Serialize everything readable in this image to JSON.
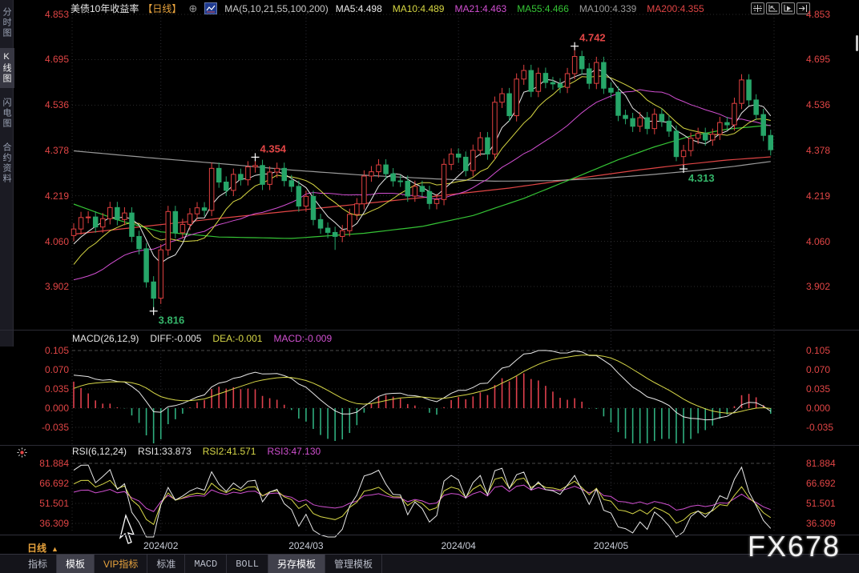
{
  "header": {
    "title": "美债10年收益率",
    "period_tag": "【日线】",
    "plus_icon": "⊕",
    "ma_label": "MA(5,10,21,55,100,200)",
    "ma_values": [
      {
        "label": "MA5:4.498",
        "color": "#e8e8e8"
      },
      {
        "label": "MA10:4.489",
        "color": "#d8d843"
      },
      {
        "label": "MA21:4.463",
        "color": "#d24fd2"
      },
      {
        "label": "MA55:4.466",
        "color": "#35c435"
      },
      {
        "label": "MA100:4.339",
        "color": "#9a9a9a"
      },
      {
        "label": "MA200:4.355",
        "color": "#e04545"
      }
    ],
    "window_icons": [
      "pan-icon",
      "axis-range-left-icon",
      "axis-play-icon",
      "page-shift-icon"
    ]
  },
  "sidebar": {
    "items": [
      {
        "label": "分时图",
        "selected": false
      },
      {
        "label": "K线图",
        "selected": true
      },
      {
        "label": "闪电图",
        "selected": false
      },
      {
        "label": "合约资料",
        "selected": false
      }
    ]
  },
  "macd_header": {
    "name": "MACD(26,12,9)",
    "diff": "DIFF:-0.005",
    "dea": "DEA:-0.001",
    "macd": "MACD:-0.009"
  },
  "rsi_header": {
    "name": "RSI(6,12,24)",
    "rsi1": "RSI1:33.873",
    "rsi2": "RSI2:41.571",
    "rsi3": "RSI3:47.130"
  },
  "bottom": {
    "period": "日线",
    "period_arrow": "▲",
    "tabs": [
      {
        "label": "指标",
        "style": "plain"
      },
      {
        "label": "模板",
        "style": "sel"
      },
      {
        "label": "VIP指标",
        "style": "vip"
      },
      {
        "label": "标准",
        "style": "plain"
      },
      {
        "label": "MACD",
        "style": "mono"
      },
      {
        "label": "BOLL",
        "style": "mono"
      },
      {
        "label": "另存模板",
        "style": "sel"
      },
      {
        "label": "管理模板",
        "style": "plain"
      }
    ]
  },
  "watermark": "FX678",
  "chart_data": {
    "type": "candlestick",
    "title": "美债10年收益率 日线",
    "main_axis_ticks": [
      "4.853",
      "4.695",
      "4.536",
      "4.378",
      "4.219",
      "4.060",
      "3.902"
    ],
    "macd_axis_ticks": [
      "0.105",
      "0.070",
      "0.035",
      "0.000",
      "-0.035"
    ],
    "rsi_axis_ticks": [
      "81.884",
      "66.692",
      "51.501",
      "36.309"
    ],
    "months": [
      {
        "label": "2024/02",
        "index": 12
      },
      {
        "label": "2024/03",
        "index": 32
      },
      {
        "label": "2024/04",
        "index": 53
      },
      {
        "label": "2024/05",
        "index": 74
      }
    ],
    "colors": {
      "up": "#e04040",
      "down": "#26a669",
      "grid": "#2b2b2b",
      "grid_bright": "#4a4a4a",
      "axis_text": "#e04545",
      "ma5": "#e8e8e8",
      "ma10": "#d8d843",
      "ma21": "#d24fd2",
      "ma55": "#35c435",
      "ma100": "#9a9a9a",
      "ma200": "#e04545",
      "macd_pos": "#e0404d",
      "macd_neg": "#2fae7e",
      "diff_line": "#e8e8e8",
      "dea_line": "#d8d848",
      "rsi1": "#e8e8e8",
      "rsi2": "#d8d848",
      "rsi3": "#d050d0",
      "annot_up": "#e04545",
      "annot_dn": "#35b56a"
    },
    "candles": [
      [
        4.08,
        4.123,
        4.06,
        4.103
      ],
      [
        4.103,
        4.163,
        4.083,
        4.143
      ],
      [
        4.143,
        4.165,
        4.123,
        4.145
      ],
      [
        4.145,
        4.165,
        4.09,
        4.11
      ],
      [
        4.11,
        4.159,
        4.09,
        4.139
      ],
      [
        4.139,
        4.198,
        4.119,
        4.178
      ],
      [
        4.178,
        4.198,
        4.116,
        4.136
      ],
      [
        4.136,
        4.179,
        4.116,
        4.159
      ],
      [
        4.159,
        4.179,
        4.057,
        4.077
      ],
      [
        4.077,
        4.097,
        4.014,
        4.034
      ],
      [
        4.034,
        4.054,
        3.898,
        3.918
      ],
      [
        3.918,
        3.938,
        3.816,
        3.861
      ],
      [
        3.861,
        4.05,
        3.841,
        4.03
      ],
      [
        4.03,
        4.184,
        4.01,
        4.164
      ],
      [
        4.164,
        4.184,
        4.07,
        4.09
      ],
      [
        4.09,
        4.139,
        4.07,
        4.119
      ],
      [
        4.119,
        4.176,
        4.099,
        4.156
      ],
      [
        4.156,
        4.197,
        4.136,
        4.177
      ],
      [
        4.177,
        4.197,
        4.148,
        4.168
      ],
      [
        4.168,
        4.335,
        4.148,
        4.315
      ],
      [
        4.315,
        4.335,
        4.247,
        4.267
      ],
      [
        4.267,
        4.287,
        4.218,
        4.238
      ],
      [
        4.238,
        4.314,
        4.218,
        4.294
      ],
      [
        4.294,
        4.314,
        4.255,
        4.275
      ],
      [
        4.275,
        4.34,
        4.255,
        4.32
      ],
      [
        4.32,
        4.354,
        4.3,
        4.325
      ],
      [
        4.325,
        4.345,
        4.239,
        4.259
      ],
      [
        4.259,
        4.322,
        4.239,
        4.302
      ],
      [
        4.302,
        4.335,
        4.282,
        4.315
      ],
      [
        4.315,
        4.335,
        4.252,
        4.272
      ],
      [
        4.272,
        4.292,
        4.232,
        4.252
      ],
      [
        4.252,
        4.272,
        4.163,
        4.183
      ],
      [
        4.183,
        4.237,
        4.163,
        4.217
      ],
      [
        4.217,
        4.237,
        4.116,
        4.136
      ],
      [
        4.136,
        4.156,
        4.086,
        4.106
      ],
      [
        4.106,
        4.126,
        4.071,
        4.091
      ],
      [
        4.091,
        4.111,
        4.03,
        4.077
      ],
      [
        4.077,
        4.117,
        4.057,
        4.097
      ],
      [
        4.097,
        4.174,
        4.077,
        4.154
      ],
      [
        4.154,
        4.211,
        4.134,
        4.191
      ],
      [
        4.191,
        4.308,
        4.171,
        4.288
      ],
      [
        4.288,
        4.323,
        4.268,
        4.303
      ],
      [
        4.303,
        4.347,
        4.283,
        4.327
      ],
      [
        4.327,
        4.347,
        4.276,
        4.296
      ],
      [
        4.296,
        4.316,
        4.251,
        4.271
      ],
      [
        4.271,
        4.291,
        4.25,
        4.27
      ],
      [
        4.27,
        4.29,
        4.198,
        4.218
      ],
      [
        4.218,
        4.272,
        4.198,
        4.252
      ],
      [
        4.252,
        4.272,
        4.214,
        4.234
      ],
      [
        4.234,
        4.254,
        4.172,
        4.192
      ],
      [
        4.192,
        4.226,
        4.172,
        4.206
      ],
      [
        4.206,
        4.349,
        4.186,
        4.329
      ],
      [
        4.329,
        4.385,
        4.309,
        4.365
      ],
      [
        4.365,
        4.385,
        4.334,
        4.354
      ],
      [
        4.354,
        4.374,
        4.287,
        4.307
      ],
      [
        4.307,
        4.398,
        4.287,
        4.378
      ],
      [
        4.378,
        4.442,
        4.358,
        4.422
      ],
      [
        4.422,
        4.442,
        4.345,
        4.365
      ],
      [
        4.365,
        4.566,
        4.345,
        4.546
      ],
      [
        4.546,
        4.596,
        4.526,
        4.576
      ],
      [
        4.576,
        4.596,
        4.479,
        4.499
      ],
      [
        4.499,
        4.647,
        4.479,
        4.627
      ],
      [
        4.627,
        4.677,
        4.607,
        4.657
      ],
      [
        4.657,
        4.677,
        4.564,
        4.584
      ],
      [
        4.584,
        4.667,
        4.564,
        4.647
      ],
      [
        4.647,
        4.667,
        4.595,
        4.615
      ],
      [
        4.615,
        4.635,
        4.59,
        4.61
      ],
      [
        4.61,
        4.63,
        4.578,
        4.598
      ],
      [
        4.598,
        4.666,
        4.578,
        4.646
      ],
      [
        4.646,
        4.742,
        4.626,
        4.706
      ],
      [
        4.706,
        4.726,
        4.643,
        4.663
      ],
      [
        4.663,
        4.683,
        4.592,
        4.612
      ],
      [
        4.612,
        4.705,
        4.592,
        4.685
      ],
      [
        4.685,
        4.705,
        4.575,
        4.595
      ],
      [
        4.595,
        4.615,
        4.561,
        4.581
      ],
      [
        4.581,
        4.601,
        4.48,
        4.5
      ],
      [
        4.5,
        4.52,
        4.469,
        4.489
      ],
      [
        4.489,
        4.509,
        4.442,
        4.462
      ],
      [
        4.462,
        4.512,
        4.442,
        4.492
      ],
      [
        4.492,
        4.512,
        4.434,
        4.454
      ],
      [
        4.454,
        4.524,
        4.434,
        4.504
      ],
      [
        4.504,
        4.524,
        4.46,
        4.48
      ],
      [
        4.48,
        4.5,
        4.425,
        4.445
      ],
      [
        4.445,
        4.465,
        4.34,
        4.356
      ],
      [
        4.356,
        4.397,
        4.313,
        4.377
      ],
      [
        4.377,
        4.44,
        4.357,
        4.42
      ],
      [
        4.42,
        4.457,
        4.4,
        4.437
      ],
      [
        4.437,
        4.457,
        4.394,
        4.414
      ],
      [
        4.414,
        4.454,
        4.394,
        4.434
      ],
      [
        4.434,
        4.495,
        4.414,
        4.475
      ],
      [
        4.475,
        4.495,
        4.447,
        4.467
      ],
      [
        4.467,
        4.562,
        4.447,
        4.542
      ],
      [
        4.542,
        4.644,
        4.522,
        4.624
      ],
      [
        4.624,
        4.644,
        4.534,
        4.554
      ],
      [
        4.554,
        4.574,
        4.483,
        4.503
      ],
      [
        4.503,
        4.523,
        4.41,
        4.43
      ],
      [
        4.43,
        4.45,
        4.36,
        4.38
      ]
    ],
    "prehistory_closes": [
      3.88,
      3.93,
      3.97,
      3.92,
      3.96,
      4.02,
      3.99,
      3.91,
      3.85,
      3.8,
      3.79,
      3.84,
      3.88,
      3.91,
      3.85,
      3.8,
      3.83,
      3.89,
      3.94,
      3.91,
      3.97,
      4.02,
      4.05,
      4.02,
      4.06
    ],
    "ma_overlays": {
      "ma55": [
        [
          0,
          4.19
        ],
        [
          6,
          4.135
        ],
        [
          12,
          4.093
        ],
        [
          20,
          4.075
        ],
        [
          30,
          4.07
        ],
        [
          40,
          4.088
        ],
        [
          48,
          4.112
        ],
        [
          55,
          4.15
        ],
        [
          62,
          4.21
        ],
        [
          69,
          4.282
        ],
        [
          75,
          4.345
        ],
        [
          80,
          4.39
        ],
        [
          85,
          4.428
        ],
        [
          90,
          4.452
        ],
        [
          96,
          4.466
        ]
      ],
      "ma100": [
        [
          0,
          4.376
        ],
        [
          10,
          4.353
        ],
        [
          20,
          4.332
        ],
        [
          30,
          4.309
        ],
        [
          40,
          4.291
        ],
        [
          50,
          4.278
        ],
        [
          58,
          4.27
        ],
        [
          66,
          4.272
        ],
        [
          73,
          4.28
        ],
        [
          80,
          4.294
        ],
        [
          86,
          4.308
        ],
        [
          91,
          4.322
        ],
        [
          96,
          4.339
        ]
      ],
      "ma200": [
        [
          0,
          4.085
        ],
        [
          10,
          4.113
        ],
        [
          20,
          4.14
        ],
        [
          30,
          4.166
        ],
        [
          40,
          4.192
        ],
        [
          50,
          4.218
        ],
        [
          60,
          4.246
        ],
        [
          70,
          4.282
        ],
        [
          78,
          4.31
        ],
        [
          84,
          4.328
        ],
        [
          90,
          4.344
        ],
        [
          96,
          4.355
        ]
      ]
    },
    "macd": {
      "params": [
        26,
        12,
        9
      ],
      "seed": {
        "ema12": 4.103,
        "ema26": 4.038,
        "dea": 0.03
      }
    },
    "rsi": {
      "periods": [
        6,
        12,
        24
      ]
    },
    "annotations": [
      {
        "index": 69,
        "value": 4.742,
        "text": "4.742",
        "side": "high"
      },
      {
        "index": 25,
        "value": 4.354,
        "text": "4.354",
        "side": "high"
      },
      {
        "index": 11,
        "value": 3.816,
        "text": "3.816",
        "side": "low"
      },
      {
        "index": 84,
        "value": 4.313,
        "text": "4.313",
        "side": "low"
      }
    ]
  }
}
